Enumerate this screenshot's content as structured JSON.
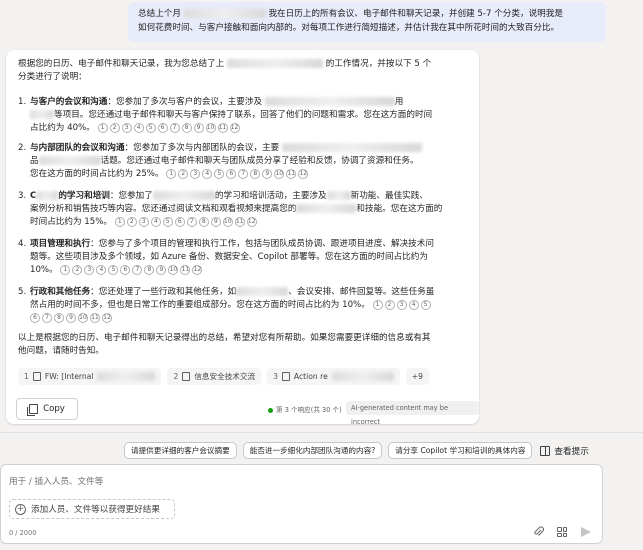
{
  "user_message": {
    "line1_pre": "总结上个月",
    "line1_post": "我在日历上的所有会议、电子邮件和聊天记录，并创建 5-7 个分类，说明我是",
    "line2": "如何花费时间、与客户接触和面向内部的。对每项工作进行简短描述，并估计我在其中所花时间的大致百分比。"
  },
  "response": {
    "intro_pre": "根据您的日历、电子邮件和聊天记录，我为您总结了上",
    "intro_post": "的工作情况，并按以下 5 个",
    "intro_line2": "分类进行了说明：",
    "items": [
      {
        "num": "1.",
        "title": "与客户的会议和沟通",
        "line1": "：您参加了多次与客户的会议，主要涉及",
        "line1_tail": "用",
        "line2_pre": "",
        "line2": "等项目。您还通过电子邮件和聊天与客户保持了联系，回答了他们的问题和需求。您在这方面的时间",
        "line3": "占比约为 40%。",
        "cites": [
          "1",
          "2",
          "3",
          "4",
          "5",
          "6",
          "7",
          "8",
          "9",
          "10",
          "11",
          "12"
        ]
      },
      {
        "num": "2.",
        "title": "与内部团队的会议和沟通",
        "line1": "：您参加了多次与内部团队的会议，主要",
        "line2_pre": "品",
        "line2": "话题。您还通过电子邮件和聊天与团队成员分享了经验和反馈，协调了资源和任务。",
        "line3": "您在这方面的时间占比约为 25%。",
        "cites": [
          "1",
          "2",
          "3",
          "4",
          "5",
          "6",
          "7",
          "8",
          "9",
          "10",
          "11",
          "12"
        ]
      },
      {
        "num": "3.",
        "title_pre": "C",
        "title": "的学习和培训",
        "line1": "：您参加了",
        "line1_mid": "的学习和培训活动，主要涉及",
        "line1_tail": "新功能、最佳实践、",
        "line2": "案例分析和销售技巧等内容。您还通过阅读文档和观看视频来提高您的",
        "line2_tail": "和技能。您在这方面的",
        "line3": "时间占比约为 15%。",
        "cites": [
          "1",
          "2",
          "3",
          "4",
          "5",
          "6",
          "7",
          "8",
          "9",
          "10",
          "11",
          "12"
        ]
      },
      {
        "num": "4.",
        "title": "项目管理和执行",
        "line1": "：您参与了多个项目的管理和执行工作，包括与团队成员协调、跟进项目进度、解决技术问",
        "line2": "题等。这些项目涉及多个领域，如 Azure 备份、数据安全、Copilot 部署等。您在这方面的时间占比约为",
        "line3": "10%。",
        "cites": [
          "1",
          "2",
          "3",
          "4",
          "5",
          "6",
          "7",
          "8",
          "9",
          "10",
          "11",
          "12"
        ]
      },
      {
        "num": "5.",
        "title": "行政和其他任务",
        "line1": "：您还处理了一些行政和其他任务，如",
        "line1_tail": "、会议安排、邮件回复等。这些任务虽",
        "line2": "然占用的时间不多，但也是日常工作的重要组成部分。您在这方面的时间占比约为 10%。",
        "cites_inline": [
          "1",
          "2",
          "3",
          "4",
          "5"
        ],
        "cites": [
          "6",
          "7",
          "8",
          "9",
          "10",
          "11",
          "12"
        ]
      }
    ],
    "outro_line1": "以上是根据您的日历、电子邮件和聊天记录得出的总结，希望对您有所帮助。如果您需要更详细的信息或有其",
    "outro_line2": "他问题，请随时告知。",
    "references": [
      {
        "num": "1",
        "label": "FW: [Internal"
      },
      {
        "num": "2",
        "label": "信息安全技术交流"
      },
      {
        "num": "3",
        "label": "Action re"
      }
    ],
    "more_refs": "+9",
    "copy_label": "Copy",
    "status_text": "第 3 个响应(共 30 个)",
    "ai_badge": "AI-generated content may be incorrect"
  },
  "suggestions": [
    "请提供更详细的客户会议摘要",
    "能否进一步细化内部团队沟通的内容?",
    "请分享 Copilot 学习和培训的具体内容"
  ],
  "view_prompts_label": "查看提示",
  "composer": {
    "placeholder": "用于 / 插入人员、文件等",
    "add_people": "添加人员、文件等以获得更好结果",
    "counter": "0 / 2000"
  },
  "icons": [
    "doc-icon",
    "copy-icon",
    "book-icon",
    "plus-icon",
    "attach-icon",
    "apps-icon",
    "send-icon"
  ]
}
